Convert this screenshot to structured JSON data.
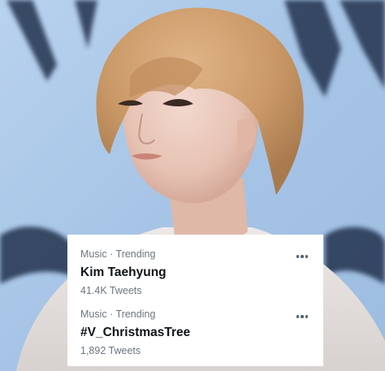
{
  "trends": [
    {
      "meta": "Music · Trending",
      "name": "Kim Taehyung",
      "count": "41.4K Tweets",
      "more_icon": "more-horizontal-icon"
    },
    {
      "meta": "Music · Trending",
      "name": "#V_ChristmasTree",
      "count": "1,892 Tweets",
      "more_icon": "more-horizontal-icon"
    }
  ],
  "colors": {
    "background": "#a9c6e6",
    "card": "#ffffff",
    "meta_text": "#6b7680",
    "name_text": "#0f1419",
    "dots": "#536471"
  }
}
